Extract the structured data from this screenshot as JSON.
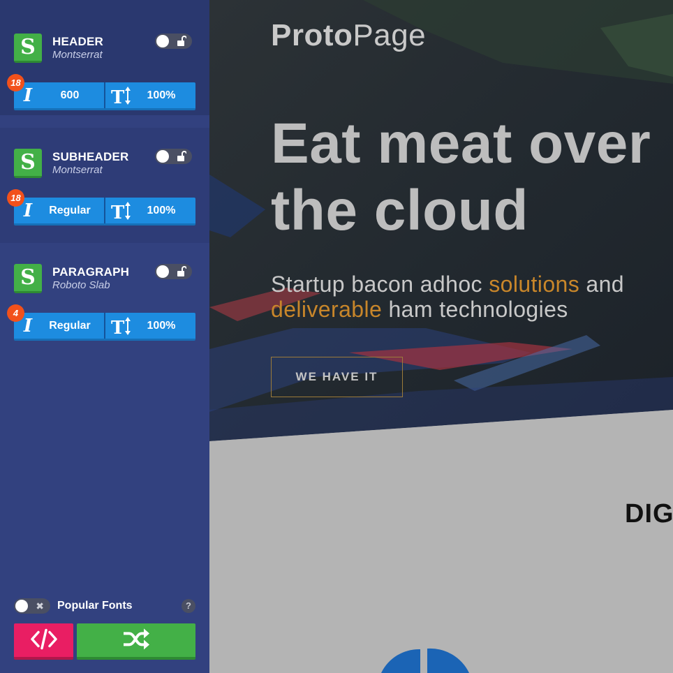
{
  "sidebar": {
    "close_label": "×",
    "logo_letter": "S",
    "sections": [
      {
        "title": "HEADER",
        "font": "Montserrat",
        "size_badge": "18",
        "weight": "600",
        "italic_label": "I",
        "line_height": "100%"
      },
      {
        "title": "SUBHEADER",
        "font": "Montserrat",
        "size_badge": "18",
        "weight": "Regular",
        "italic_label": "I",
        "line_height": "100%"
      },
      {
        "title": "PARAGRAPH",
        "font": "Roboto Slab",
        "size_badge": "4",
        "weight": "Regular",
        "italic_label": "I",
        "line_height": "100%"
      }
    ],
    "popular_fonts_label": "Popular Fonts",
    "popular_fonts_enabled": false,
    "help_label": "?",
    "toggle_off_label": "✖"
  },
  "preview": {
    "brand_bold": "Proto",
    "brand_light": "Page",
    "headline_line1": "Eat meat over",
    "headline_line2": "the cloud",
    "sub_part1": "Startup bacon adhoc ",
    "sub_hl1": "solutions",
    "sub_part2": " and",
    "sub_hl2": "deliverable",
    "sub_part3": " ham technologies",
    "cta_label": "WE HAVE IT",
    "section_title": "DIGI"
  },
  "colors": {
    "sidebar_bg": "#32417f",
    "accent_blue": "#1d8ce0",
    "accent_green": "#43b047",
    "accent_pink": "#e91e63",
    "badge_orange": "#f2511b",
    "highlight_gold": "#c8862a"
  },
  "icons": [
    "close-icon",
    "font-logo-icon",
    "lock-open-icon",
    "italic-icon",
    "text-height-icon",
    "code-icon",
    "shuffle-icon",
    "help-icon"
  ]
}
